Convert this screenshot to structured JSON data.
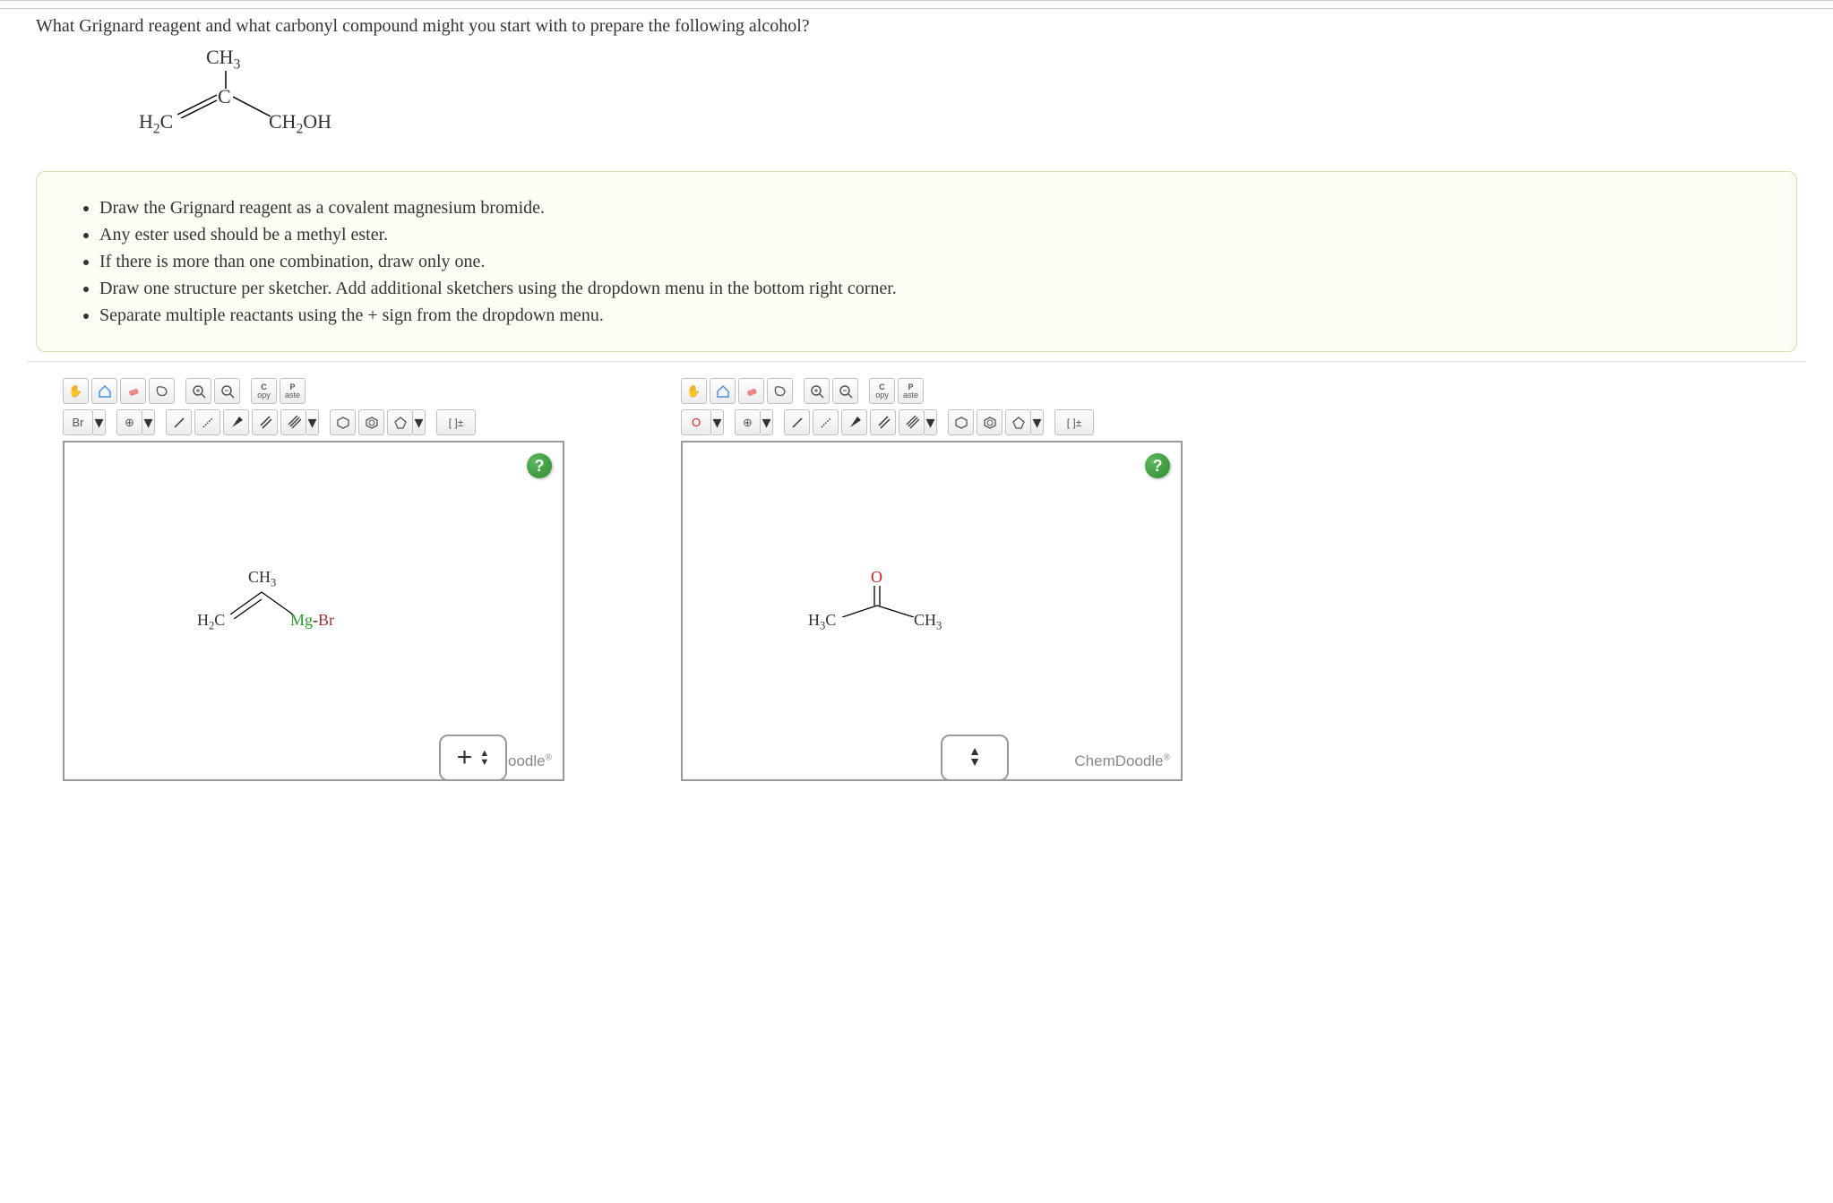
{
  "question": "What Grignard reagent and what carbonyl compound might you start with to prepare the following alcohol?",
  "target_molecule": {
    "labels": {
      "ch3": "CH₃",
      "c": "C",
      "h2c": "H₂C",
      "ch2oh": "CH₂OH"
    }
  },
  "instructions": [
    "Draw the Grignard reagent as a covalent magnesium bromide.",
    "Any ester used should be a methyl ester.",
    "If there is more than one combination, draw only one.",
    "Draw one structure per sketcher. Add additional sketchers using the dropdown menu in the bottom right corner.",
    "Separate multiple reactants using the + sign from the dropdown menu."
  ],
  "toolbar": {
    "copy": "C\nopy",
    "paste": "P\naste",
    "charge": "[ ]±",
    "element_left": "Br",
    "element_right": "O"
  },
  "canvas_left": {
    "labels": {
      "ch3": "CH₃",
      "h2c": "H₂C",
      "mg": "Mg",
      "br": "Br"
    }
  },
  "canvas_right": {
    "labels": {
      "o": "O",
      "h3c_left": "H₃C",
      "ch3_right": "CH₃"
    }
  },
  "brand": "ChemDoodle",
  "help": "?",
  "plus": "+",
  "icons": {
    "hand": "✋",
    "home": "⌂",
    "eraser": "⌫",
    "undo": "↶",
    "redo": "↷",
    "zoomin": "⊕",
    "zoomout": "⊖"
  }
}
